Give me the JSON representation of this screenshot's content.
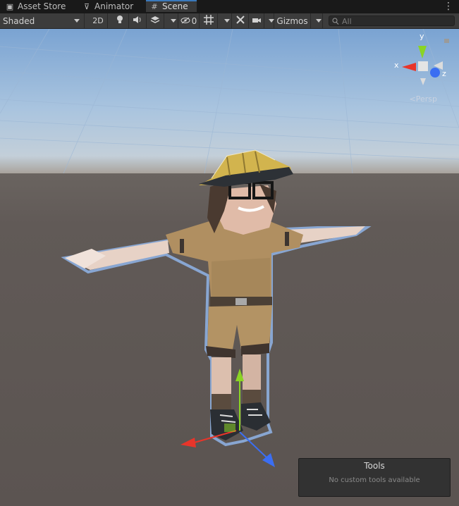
{
  "tabs": [
    {
      "label": "Asset Store",
      "icon": "shopping-bag-icon",
      "active": false
    },
    {
      "label": "Animator",
      "icon": "animator-icon",
      "active": false
    },
    {
      "label": "Scene",
      "icon": "grid-hash-icon",
      "active": true
    }
  ],
  "toolbar": {
    "draw_mode": "Shaded",
    "mode_2d": "2D",
    "hidden_count": "0",
    "gizmos_label": "Gizmos",
    "search_placeholder": "All"
  },
  "orientation_gizmo": {
    "y_label": "y",
    "x_label": "x",
    "z_label": "z"
  },
  "projection_label": "Persp",
  "tools_overlay": {
    "title": "Tools",
    "message": "No custom tools available"
  },
  "colors": {
    "accent": "#3a79bb",
    "x_axis": "#e8352a",
    "y_axis": "#8ad424",
    "z_axis": "#3b6ef2"
  }
}
